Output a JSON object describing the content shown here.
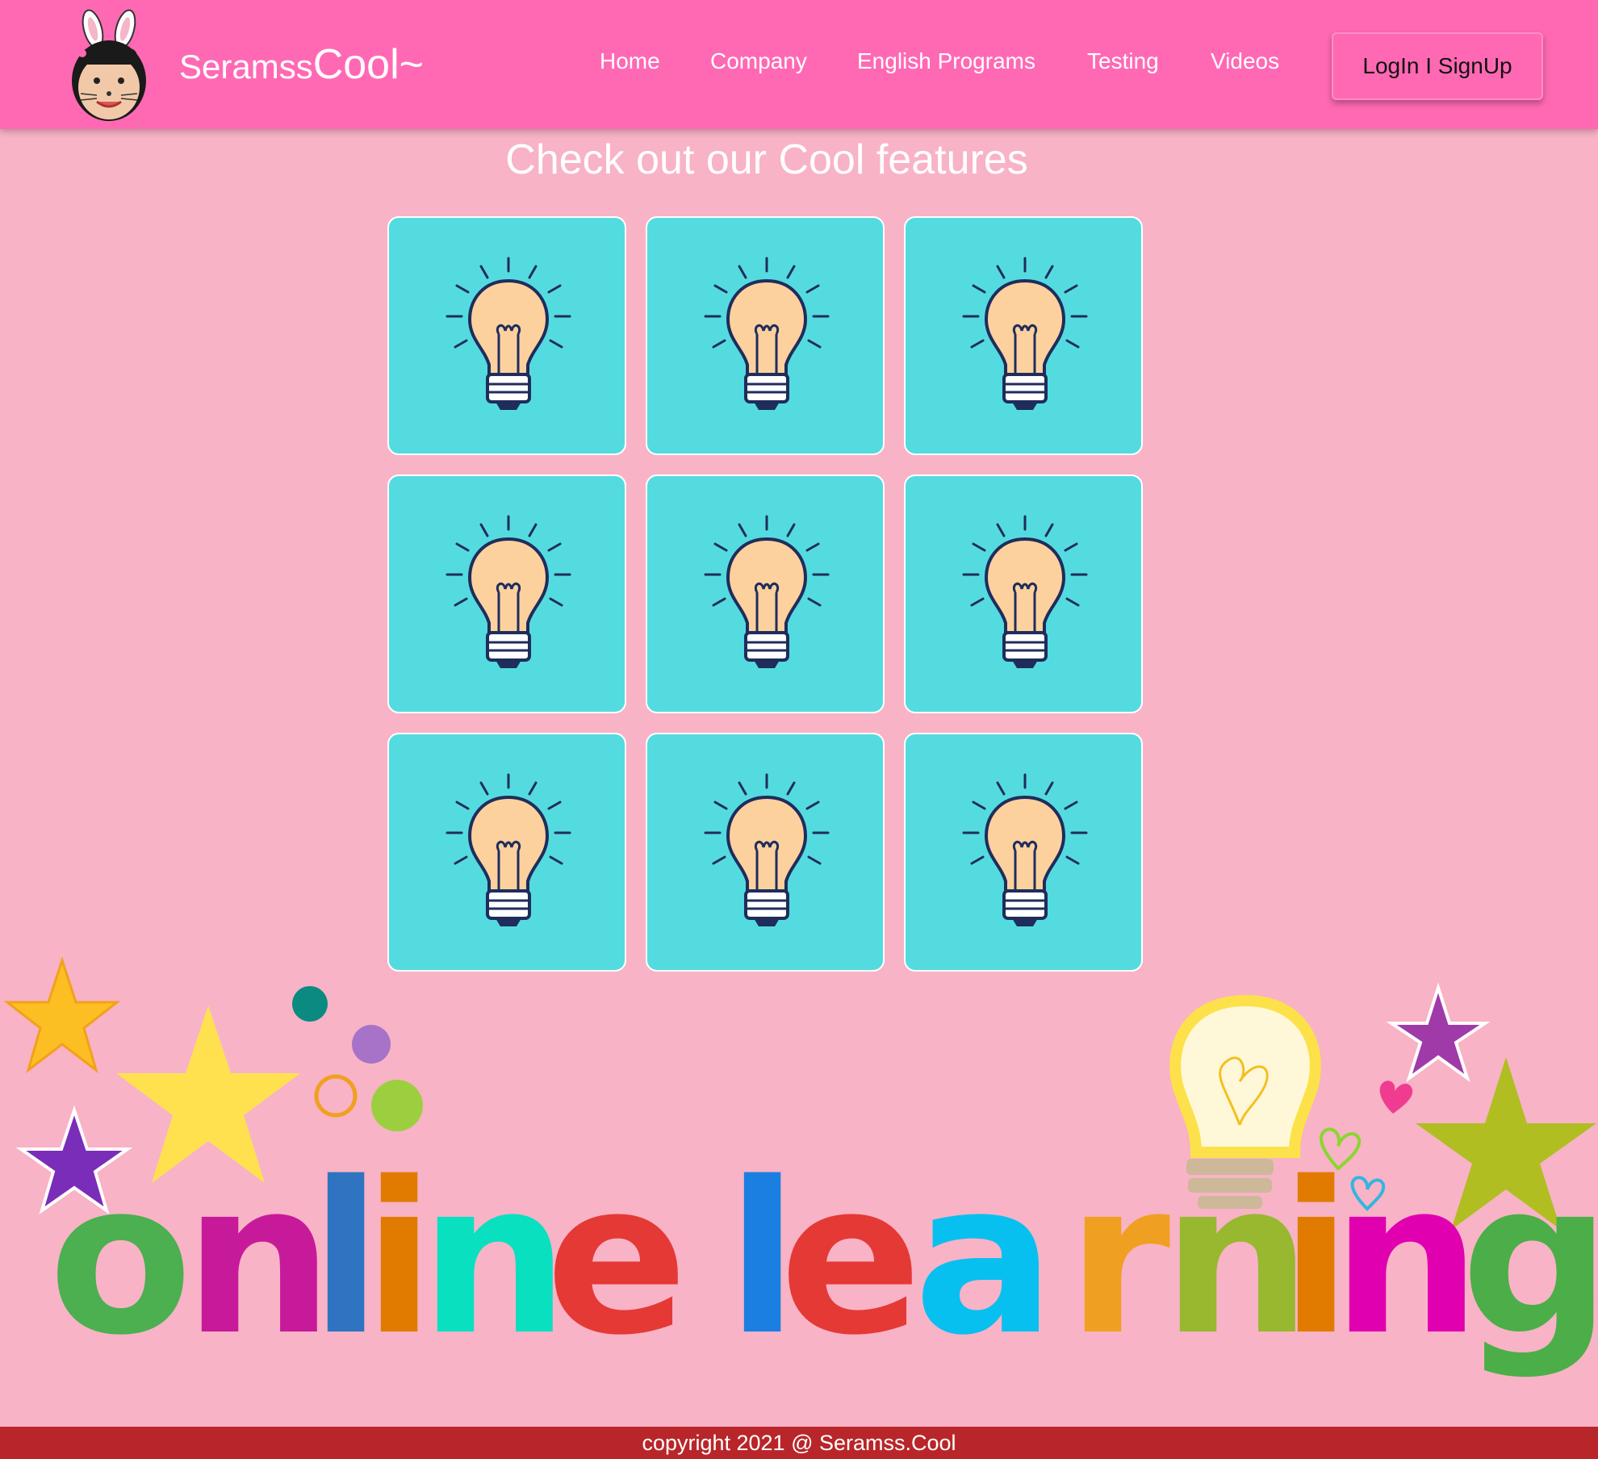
{
  "navbar": {
    "brand_part1": "Seramss",
    "brand_part2": "Cool~",
    "links": [
      "Home",
      "Company",
      "English Programs",
      "Testing",
      "Videos"
    ],
    "login_label": "LogIn I SignUp",
    "color": "#ff69b4"
  },
  "features": {
    "title": "Check out our Cool features",
    "tile_count": 9,
    "tile_icon": "light-bulb-icon",
    "tile_color": "#54dbe0"
  },
  "banner": {
    "letters": [
      "o",
      "n",
      "l",
      "i",
      "n",
      "e",
      "l",
      "e",
      "a",
      "r",
      "n",
      "i",
      "n",
      "g"
    ],
    "letter_colors": [
      "#4caf50",
      "#c71a9a",
      "#2f74c0",
      "#e07b00",
      "#08e0c0",
      "#e53935",
      "#1a7fe0",
      "#e53935",
      "#08c0f0",
      "#f0a020",
      "#98b830",
      "#e07b00",
      "#e000b0",
      "#4cae48"
    ],
    "decor_icons": [
      "star-icon",
      "dot-icon",
      "light-bulb-icon",
      "heart-icon"
    ]
  },
  "footer": {
    "copyright": "copyright 2021 @ Seramss.Cool",
    "color": "#b8262a"
  }
}
